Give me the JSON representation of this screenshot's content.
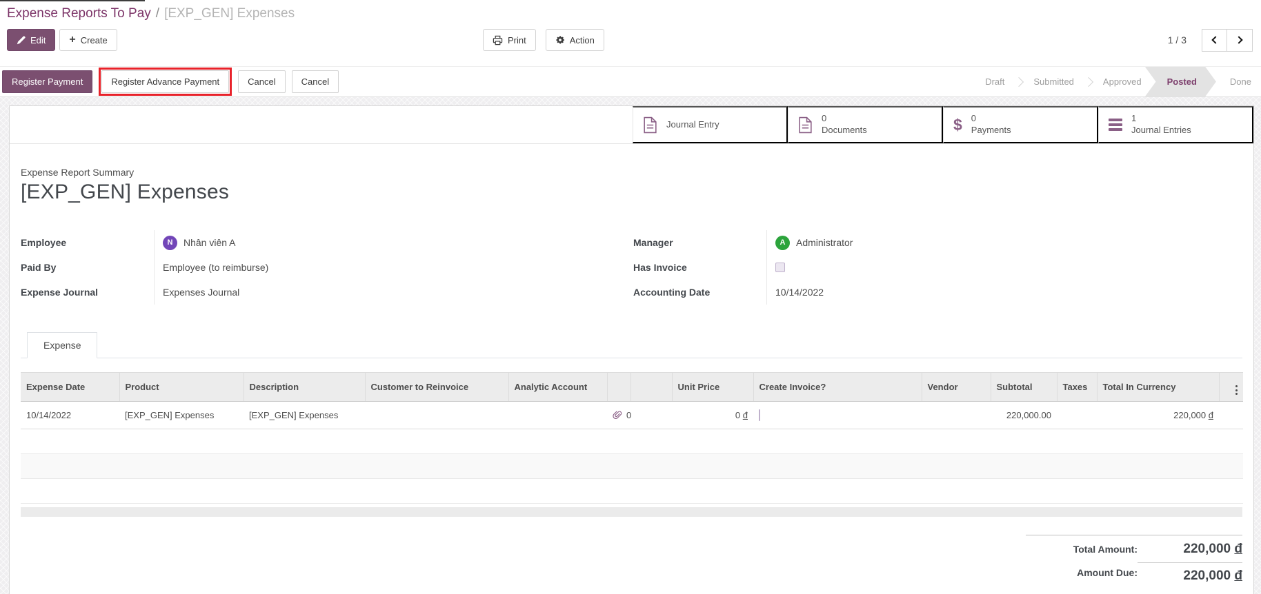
{
  "breadcrumb": {
    "parent": "Expense Reports To Pay",
    "separator": "/",
    "current": "[EXP_GEN] Expenses"
  },
  "toolbar": {
    "edit": "Edit",
    "create": "Create",
    "print": "Print",
    "action": "Action",
    "pager": "1 / 3"
  },
  "statusbar": {
    "register_payment": "Register Payment",
    "register_advance_payment": "Register Advance Payment",
    "cancel1": "Cancel",
    "cancel2": "Cancel",
    "highlight_color": "#e8222a",
    "states": [
      {
        "label": "Draft",
        "active": false
      },
      {
        "label": "Submitted",
        "active": false
      },
      {
        "label": "Approved",
        "active": false
      },
      {
        "label": "Posted",
        "active": true
      },
      {
        "label": "Done",
        "active": false
      }
    ]
  },
  "smart_buttons": [
    {
      "icon": "journal-entry-icon",
      "count": "",
      "label": "Journal Entry"
    },
    {
      "icon": "documents-icon",
      "count": "0",
      "label": "Documents"
    },
    {
      "icon": "payments-icon",
      "count": "0",
      "label": "Payments"
    },
    {
      "icon": "journal-entries-icon",
      "count": "1",
      "label": "Journal Entries"
    }
  ],
  "form": {
    "summary_label": "Expense Report Summary",
    "title": "[EXP_GEN] Expenses",
    "employee": {
      "label": "Employee",
      "value": "Nhân viên A",
      "avatar_letter": "N",
      "avatar_color": "#7246b8"
    },
    "paid_by": {
      "label": "Paid By",
      "value": "Employee (to reimburse)"
    },
    "expense_journal": {
      "label": "Expense Journal",
      "value": "Expenses Journal"
    },
    "manager": {
      "label": "Manager",
      "value": "Administrator",
      "avatar_letter": "A",
      "avatar_color": "#2ca43c"
    },
    "has_invoice": {
      "label": "Has Invoice",
      "checked": false
    },
    "accounting_date": {
      "label": "Accounting Date",
      "value": "10/14/2022"
    }
  },
  "notebook": {
    "tab": "Expense"
  },
  "table": {
    "headers": {
      "expense_date": "Expense Date",
      "product": "Product",
      "description": "Description",
      "customer_to_reinvoice": "Customer to Reinvoice",
      "analytic_account": "Analytic Account",
      "unit_price": "Unit Price",
      "create_invoice": "Create Invoice?",
      "vendor": "Vendor",
      "subtotal": "Subtotal",
      "taxes": "Taxes",
      "total_in_currency": "Total In Currency"
    },
    "row": {
      "expense_date": "10/14/2022",
      "product": "[EXP_GEN] Expenses",
      "description": "[EXP_GEN] Expenses",
      "attachment_count": "0",
      "unit_price": "0",
      "currency": "đ",
      "create_invoice_checked": false,
      "subtotal": "220,000.00",
      "total_in_currency": "220,000"
    }
  },
  "totals": {
    "total_amount_label": "Total Amount:",
    "total_amount": "220,000",
    "amount_due_label": "Amount Due:",
    "amount_due": "220,000",
    "currency": "đ"
  },
  "colors": {
    "brand": "#7b4f70",
    "active_state_text": "#7d3f6d",
    "icon_purple": "#8a5f86"
  }
}
